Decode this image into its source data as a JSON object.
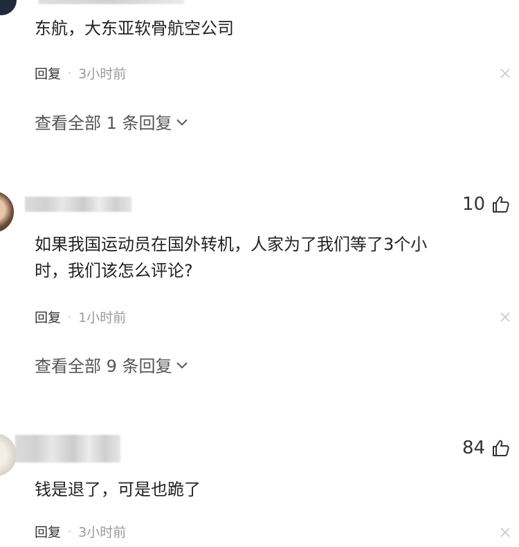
{
  "comments": [
    {
      "text": "东航，大东亚软骨航空公司",
      "reply_label": "回复",
      "separator": "·",
      "time": "3小时前",
      "view_replies": "查看全部 1 条回复"
    },
    {
      "like_count": "10",
      "text_line1": "如果我国运动员在国外转机，人家为了我们等了3个小",
      "text_line2": "时，我们该怎么评论?",
      "reply_label": "回复",
      "separator": "·",
      "time": "1小时前",
      "view_replies": "查看全部 9 条回复"
    },
    {
      "like_count": "84",
      "text": "钱是退了，可是也跪了",
      "reply_label": "回复",
      "separator": "·",
      "time": "3小时前"
    }
  ],
  "colors": {
    "text": "#222222",
    "meta": "#999999",
    "link": "#555555"
  },
  "icons": {
    "like": "thumbs-up-icon",
    "close": "close-icon",
    "expand": "chevron-down-icon"
  }
}
